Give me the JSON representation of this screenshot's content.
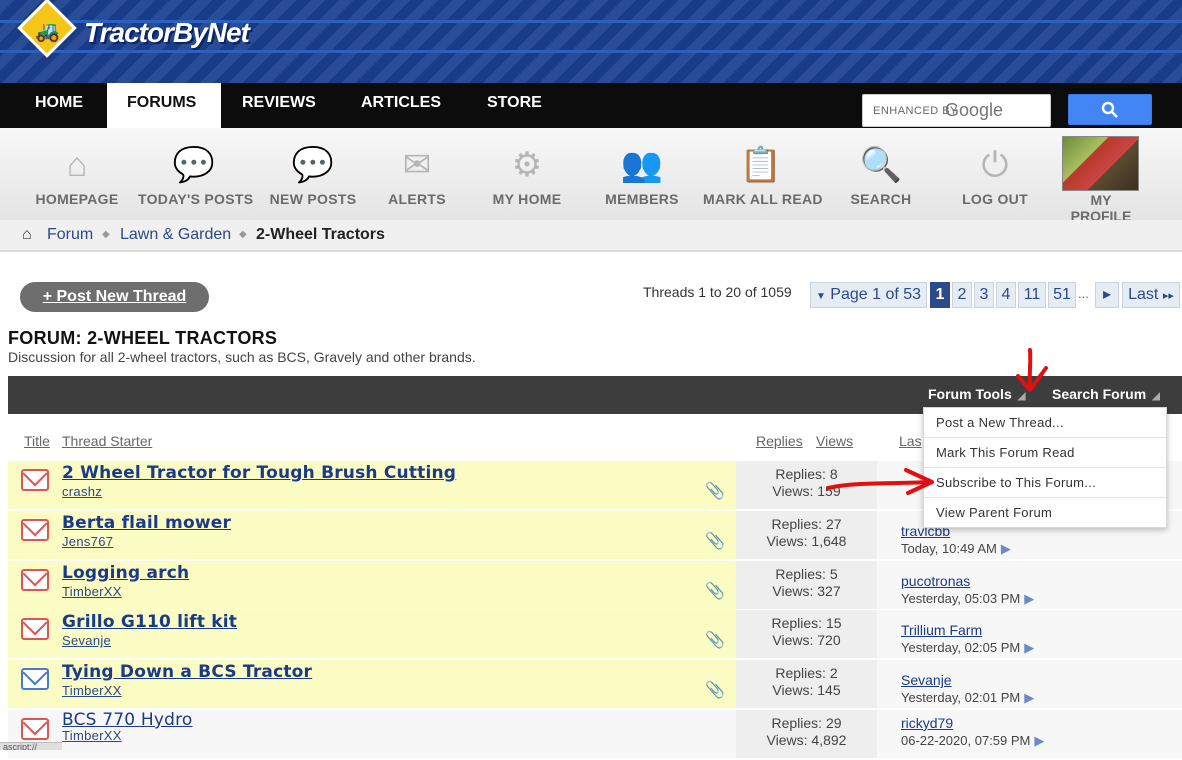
{
  "site": {
    "logo_text": "TractorByNet"
  },
  "topnav": {
    "items": [
      "HOME",
      "FORUMS",
      "REVIEWS",
      "ARTICLES",
      "STORE"
    ],
    "active": "FORUMS"
  },
  "search": {
    "enhanced_by": "ENHANCED BY",
    "google": "Google",
    "button_icon": "search-icon"
  },
  "iconbar": {
    "items": [
      {
        "label": "HOMEPAGE",
        "icon": "house-icon"
      },
      {
        "label": "TODAY'S POSTS",
        "icon": "speech-bubbles-icon"
      },
      {
        "label": "NEW POSTS",
        "icon": "speech-bubble-star-icon"
      },
      {
        "label": "ALERTS",
        "icon": "envelope-icon"
      },
      {
        "label": "MY HOME",
        "icon": "gear-icon"
      },
      {
        "label": "MEMBERS",
        "icon": "people-icon"
      },
      {
        "label": "MARK ALL READ",
        "icon": "checklist-icon"
      },
      {
        "label": "SEARCH",
        "icon": "magnifier-icon"
      },
      {
        "label": "LOG OUT",
        "icon": "power-icon"
      }
    ],
    "profile_label": "MY PROFILE"
  },
  "breadcrumb": {
    "items": [
      "Forum",
      "Lawn & Garden",
      "2-Wheel Tractors"
    ]
  },
  "actions": {
    "post_new_thread": "+ Post New Thread"
  },
  "pagination": {
    "summary": "Threads 1 to 20 of 1059",
    "page_label": "Page 1 of 53",
    "pages": [
      "1",
      "2",
      "3",
      "4",
      "11",
      "51"
    ],
    "current": "1",
    "ellipsis": "...",
    "next": "▸",
    "last": "Last"
  },
  "forum": {
    "title": "FORUM: 2-WHEEL TRACTORS",
    "description": "Discussion for all 2-wheel tractors, such as BCS, Gravely and other brands."
  },
  "toolbar": {
    "forum_tools": "Forum Tools",
    "search_forum": "Search Forum"
  },
  "forum_tools_menu": [
    "Post a New Thread...",
    "Mark This Forum Read",
    "Subscribe to This Forum...",
    "View Parent Forum"
  ],
  "columns": {
    "title": "Title",
    "starter": "Thread Starter",
    "replies": "Replies",
    "views": "Views",
    "last": "Las"
  },
  "threads": [
    {
      "title": "2 Wheel Tractor for Tough Brush Cutting",
      "starter": "crashz",
      "replies": "Replies: 8",
      "views": "Views: 159",
      "last_user": "",
      "last_time": "",
      "highlight": true,
      "attachment": true,
      "icon": "envelope-red-icon"
    },
    {
      "title": "Berta flail mower",
      "starter": "Jens767",
      "replies": "Replies: 27",
      "views": "Views: 1,648",
      "last_user": "travlcbb",
      "last_time": "Today, 10:49 AM",
      "highlight": true,
      "attachment": true,
      "icon": "envelope-red-icon"
    },
    {
      "title": "Logging arch",
      "starter": "TimberXX",
      "replies": "Replies: 5",
      "views": "Views: 327",
      "last_user": "pucotronas",
      "last_time": "Yesterday, 05:03 PM",
      "highlight": true,
      "attachment": true,
      "icon": "envelope-red-icon"
    },
    {
      "title": "Grillo G110 lift kit",
      "starter": "Sevanje",
      "replies": "Replies: 15",
      "views": "Views: 720",
      "last_user": "Trillium Farm",
      "last_time": "Yesterday, 02:05 PM",
      "highlight": true,
      "attachment": true,
      "icon": "envelope-red-icon"
    },
    {
      "title": "Tying Down a BCS Tractor",
      "starter": "TimberXX",
      "replies": "Replies: 2",
      "views": "Views: 145",
      "last_user": "Sevanje",
      "last_time": "Yesterday, 02:01 PM",
      "highlight": true,
      "attachment": true,
      "icon": "envelope-blue-icon"
    },
    {
      "title": "BCS 770 Hydro",
      "starter": "TimberXX",
      "replies": "Replies: 29",
      "views": "Views: 4,892",
      "last_user": "rickyd79",
      "last_time": "06-22-2020, 07:59 PM",
      "highlight": false,
      "attachment": false,
      "icon": "envelope-red-icon"
    }
  ],
  "statusbar": {
    "text": "ascript://"
  }
}
